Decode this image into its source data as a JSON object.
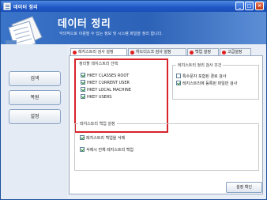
{
  "window": {
    "title": "데이터 정리"
  },
  "header": {
    "title": "데이터 정리",
    "subtitle": "악의적으로 이용될 수 있는 정보 및 시스템 파일을 정리 합니다."
  },
  "sidebar": {
    "buttons": [
      "검색",
      "복원",
      "설정"
    ]
  },
  "tabs": [
    "레지스트리 검사 설정",
    "하드디스크 검사 설정",
    "백업 설정",
    "고급설정"
  ],
  "registry_select": {
    "label": "정리할 레지스트리 선택",
    "items": [
      {
        "label": "HKEY CLASSES ROOT",
        "checked": true
      },
      {
        "label": "HKEY CURRENT USER",
        "checked": true
      },
      {
        "label": "HKEY LOCAL MACHINE",
        "checked": true
      },
      {
        "label": "HKEY USERS",
        "checked": true
      }
    ]
  },
  "cleanup_conditions": {
    "label": "레지스트리 정리 검사 조건",
    "items": [
      {
        "label": "특수문자 포함된 경로 검사",
        "checked": false
      },
      {
        "label": "레지스트리에 등록된 파일만 검사",
        "checked": true
      }
    ]
  },
  "backup": {
    "label": "레지스트리 백업 설정",
    "items": [
      {
        "label": "레지스트리 백업을 삭제",
        "checked": true
      },
      {
        "label": "삭제시 전체 레지스트리 백업",
        "checked": true
      }
    ]
  },
  "confirm_label": "설정 확인"
}
